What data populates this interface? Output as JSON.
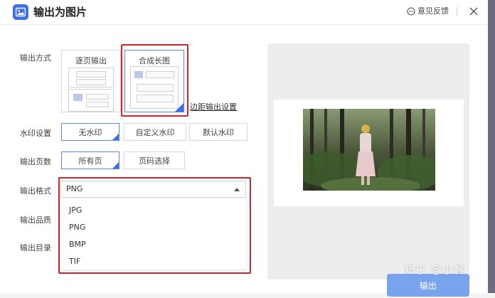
{
  "title": "输出为图片",
  "feedback_label": "意见反馈",
  "output_mode": {
    "label": "输出方式",
    "options": [
      "逐页输出",
      "合成长图"
    ],
    "selected": "合成长图"
  },
  "margin_link": "边距输出设置",
  "watermark": {
    "label": "水印设置",
    "options": [
      "无水印",
      "自定义水印",
      "默认水印"
    ],
    "selected": "无水印"
  },
  "pages": {
    "label": "输出页数",
    "options": [
      "所有页",
      "页码选择"
    ],
    "selected": "所有页"
  },
  "format": {
    "label": "输出格式",
    "value": "PNG",
    "options": [
      "JPG",
      "PNG",
      "BMP",
      "TIF"
    ]
  },
  "quality_label": "输出品质",
  "directory_label": "输出目录",
  "export_button": "输出",
  "watermark_text": "知乎 @小智",
  "icons": {
    "app": "image-export-icon",
    "feedback": "chat-bubble-icon",
    "close": "close-icon",
    "select": "caret-up-icon"
  },
  "colors": {
    "accent": "#3f6ee8",
    "highlight": "#c8252c",
    "export_button": "#7aa3ee"
  }
}
